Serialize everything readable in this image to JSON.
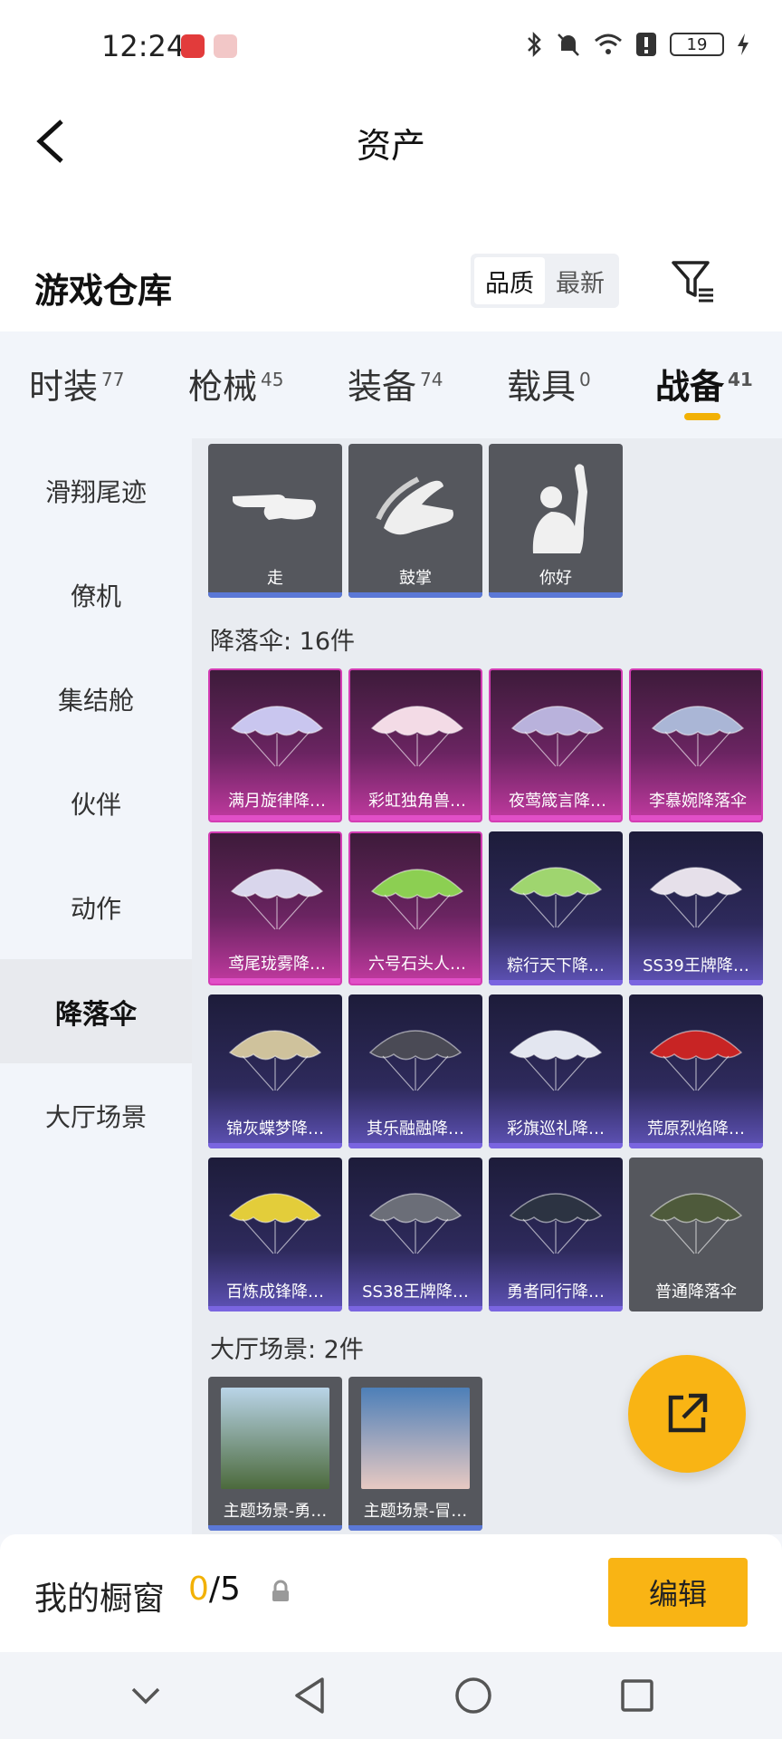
{
  "status": {
    "time": "12:24",
    "battery": "19"
  },
  "header": {
    "title": "资产"
  },
  "warehouse": {
    "title": "游戏仓库",
    "sort_options": [
      "品质",
      "最新"
    ]
  },
  "tabs": [
    {
      "label": "时装",
      "count": "77"
    },
    {
      "label": "枪械",
      "count": "45"
    },
    {
      "label": "装备",
      "count": "74"
    },
    {
      "label": "载具",
      "count": "0"
    },
    {
      "label": "战备",
      "count": "41"
    }
  ],
  "sidebar": [
    "滑翔尾迹",
    "僚机",
    "集结舱",
    "伙伴",
    "动作",
    "降落伞",
    "大厅场景"
  ],
  "emotes": [
    "走",
    "鼓掌",
    "你好"
  ],
  "parachute_section": "降落伞: 16件",
  "parachutes": [
    {
      "name": "满月旋律降…",
      "tier": "purple",
      "color": "#c9c6ef"
    },
    {
      "name": "彩虹独角兽…",
      "tier": "purple",
      "color": "#f3dbe6"
    },
    {
      "name": "夜莺箴言降…",
      "tier": "purple",
      "color": "#b9b2dc"
    },
    {
      "name": "李慕婉降落伞",
      "tier": "purple",
      "color": "#aab6d6"
    },
    {
      "name": "鸢尾珑雾降…",
      "tier": "purple",
      "color": "#d9d6ec"
    },
    {
      "name": "六号石头人…",
      "tier": "purple",
      "color": "#8ccf52"
    },
    {
      "name": "粽行天下降…",
      "tier": "blue",
      "color": "#9fd56f"
    },
    {
      "name": "SS39王牌降…",
      "tier": "blue",
      "color": "#e6e0ea"
    },
    {
      "name": "锦灰蝶梦降…",
      "tier": "blue",
      "color": "#cfc29c"
    },
    {
      "name": "其乐融融降…",
      "tier": "blue",
      "color": "#4a4a55"
    },
    {
      "name": "彩旗巡礼降…",
      "tier": "blue",
      "color": "#e3e6f0"
    },
    {
      "name": "荒原烈焰降…",
      "tier": "blue",
      "color": "#c82424"
    },
    {
      "name": "百炼成锋降…",
      "tier": "blue",
      "color": "#e3cd3a"
    },
    {
      "name": "SS38王牌降…",
      "tier": "blue",
      "color": "#6b6e78"
    },
    {
      "name": "勇者同行降…",
      "tier": "blue",
      "color": "#2c3342"
    },
    {
      "name": "普通降落伞",
      "tier": "plain",
      "color": "#4e5a3b"
    }
  ],
  "scene_section": "大厅场景: 2件",
  "scenes": [
    {
      "name": "主题场景-勇…",
      "color_top": "#b9d4e8",
      "color_bottom": "#4c6a3c"
    },
    {
      "name": "主题场景-冒…",
      "color_top": "#4d7fb8",
      "color_bottom": "#e7c9c2"
    }
  ],
  "showcase": {
    "title": "我的橱窗",
    "current": "0",
    "total": "/5",
    "edit_label": "编辑"
  }
}
